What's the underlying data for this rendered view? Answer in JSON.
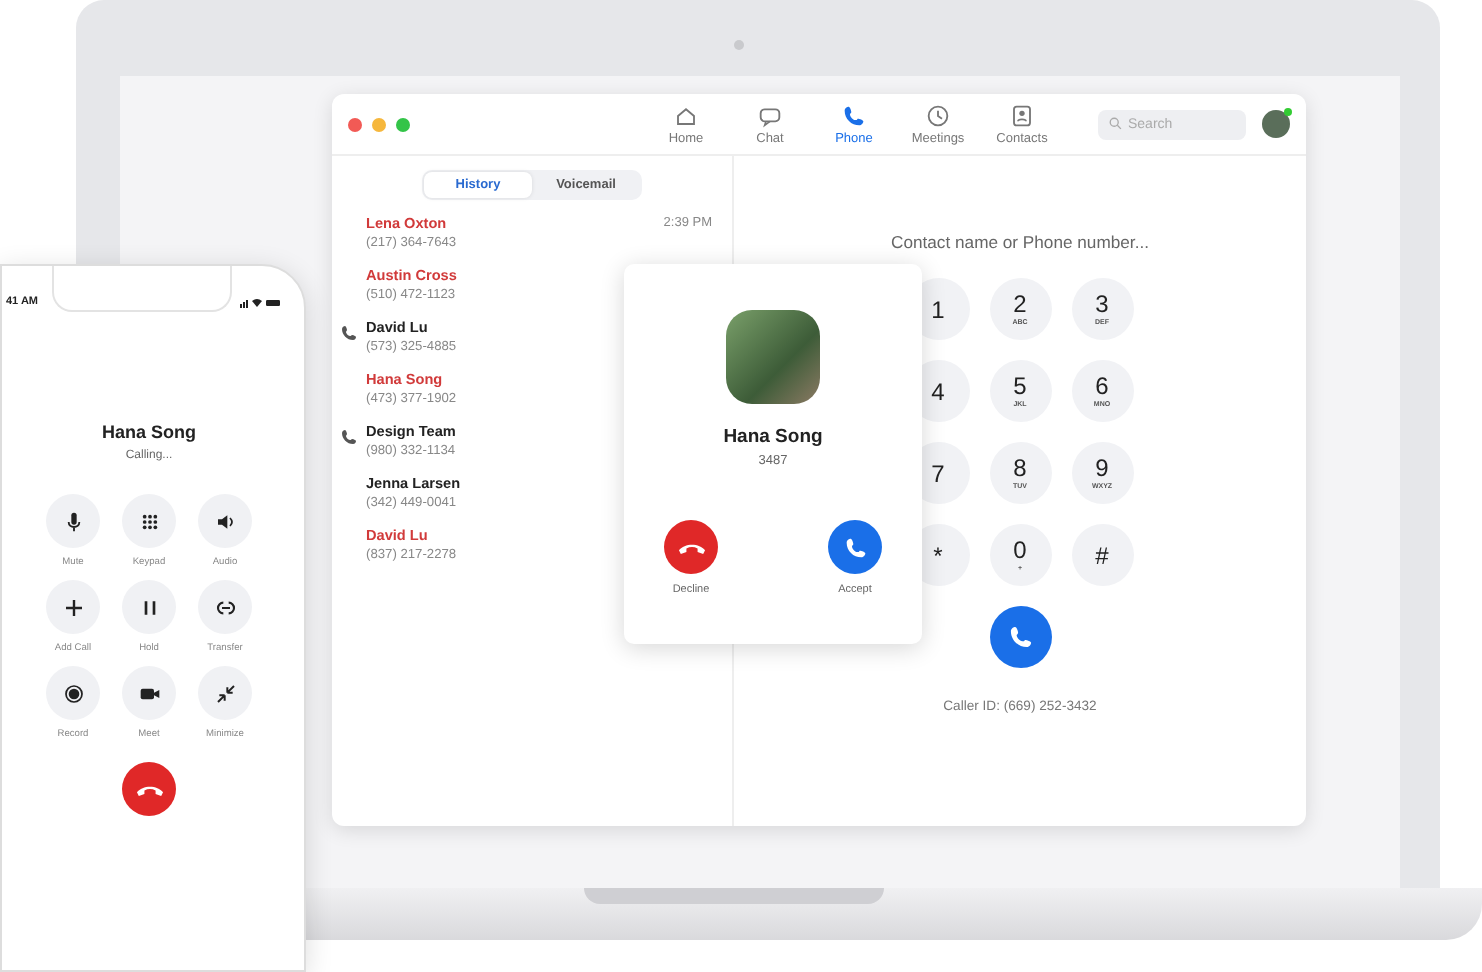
{
  "app": {
    "nav": [
      {
        "label": "Home",
        "selected": false
      },
      {
        "label": "Chat",
        "selected": false
      },
      {
        "label": "Phone",
        "selected": true
      },
      {
        "label": "Meetings",
        "selected": false
      },
      {
        "label": "Contacts",
        "selected": false
      }
    ],
    "search": {
      "placeholder": "Search"
    },
    "tabs": [
      {
        "label": "History",
        "selected": true
      },
      {
        "label": "Voicemail",
        "selected": false
      }
    ],
    "calls": [
      {
        "name": "Lena Oxton",
        "number": "(217) 364-7643",
        "missed": true,
        "outgoing": false,
        "time": "2:39 PM"
      },
      {
        "name": "Austin Cross",
        "number": "(510) 472-1123",
        "missed": true,
        "outgoing": false
      },
      {
        "name": "David Lu",
        "number": "(573) 325-4885",
        "missed": false,
        "outgoing": true
      },
      {
        "name": "Hana Song",
        "number": "(473) 377-1902",
        "missed": true,
        "outgoing": false
      },
      {
        "name": "Design Team",
        "number": "(980) 332-1134",
        "missed": false,
        "outgoing": true
      },
      {
        "name": "Jenna Larsen",
        "number": "(342) 449-0041",
        "missed": false,
        "outgoing": false
      },
      {
        "name": "David Lu",
        "number": "(837) 217-2278",
        "missed": true,
        "outgoing": false
      }
    ],
    "dialer": {
      "placeholder": "Contact name or Phone number...",
      "keys": [
        {
          "digit": "1"
        },
        {
          "digit": "2",
          "letters": "ABC"
        },
        {
          "digit": "3",
          "letters": "DEF"
        },
        {
          "digit": "4"
        },
        {
          "digit": "5",
          "letters": "JKL"
        },
        {
          "digit": "6",
          "letters": "MNO"
        },
        {
          "digit": "7"
        },
        {
          "digit": "8",
          "letters": "TUV"
        },
        {
          "digit": "9",
          "letters": "WXYZ"
        },
        {
          "digit": "*"
        },
        {
          "digit": "0",
          "letters": "+"
        },
        {
          "digit": "#"
        }
      ],
      "caller_id": "Caller ID: (669) 252-3432"
    },
    "incoming": {
      "name": "Hana Song",
      "extension": "3487",
      "decline": "Decline",
      "accept": "Accept"
    }
  },
  "phone": {
    "time": "41 AM",
    "caller": "Hana Song",
    "status": "Calling...",
    "controls": [
      {
        "label": "Mute"
      },
      {
        "label": "Keypad"
      },
      {
        "label": "Audio"
      },
      {
        "label": "Add Call"
      },
      {
        "label": "Hold"
      },
      {
        "label": "Transfer"
      },
      {
        "label": "Record"
      },
      {
        "label": "Meet"
      },
      {
        "label": "Minimize"
      }
    ]
  }
}
